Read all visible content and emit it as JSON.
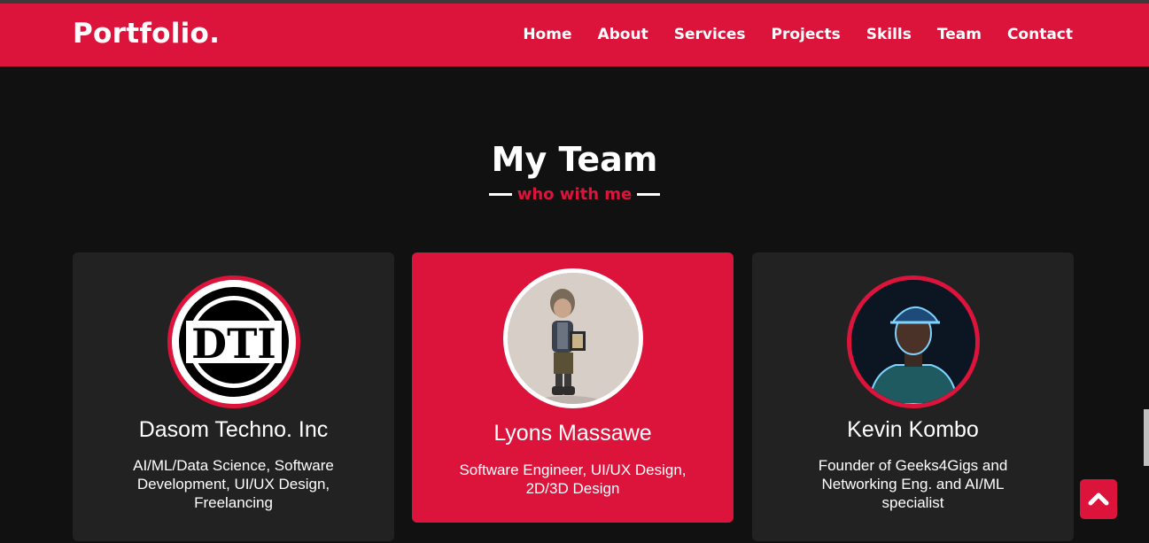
{
  "header": {
    "logo": "Portfolio.",
    "nav": [
      "Home",
      "About",
      "Services",
      "Projects",
      "Skills",
      "Team",
      "Contact"
    ]
  },
  "section": {
    "title": "My Team",
    "subtitle": "who with me"
  },
  "team": [
    {
      "name": "Dasom Techno. Inc",
      "role": "AI/ML/Data Science, Software Development, UI/UX Design, Freelancing",
      "avatar_text": "DTI"
    },
    {
      "name": "Lyons Massawe",
      "role": "Software Engineer, UI/UX Design, 2D/3D Design"
    },
    {
      "name": "Kevin Kombo",
      "role": "Founder of Geeks4Gigs and Networking Eng. and AI/ML specialist"
    }
  ],
  "colors": {
    "accent": "#dc143c",
    "background": "#111111",
    "card": "#222222"
  },
  "icons": {
    "scroll_top": "chevron-up-icon"
  }
}
